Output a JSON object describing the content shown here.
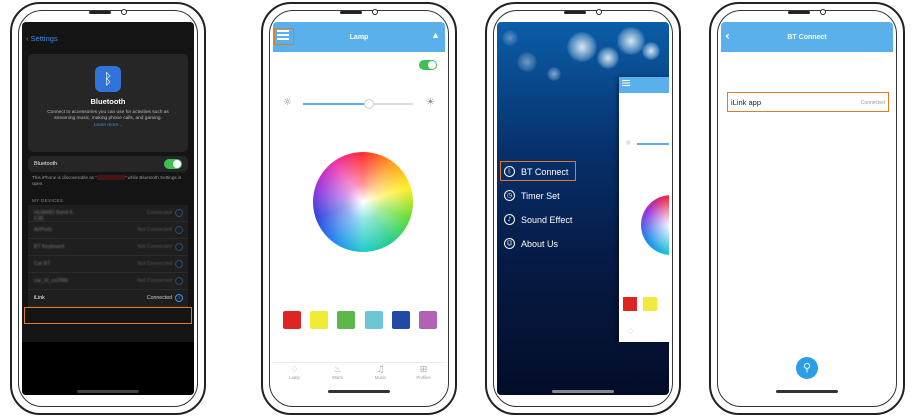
{
  "phone1": {
    "back_label": "Settings",
    "icon": "bluetooth-icon",
    "title": "Bluetooth",
    "description": "Connect to accessories you can use for activities such as streaming music, making phone calls, and gaming.",
    "learn_more": "Learn more...",
    "toggle_label": "Bluetooth",
    "toggle_on": true,
    "discoverable_prefix": "This iPhone is discoverable as “",
    "discoverable_suffix": "” while Bluetooth Settings is open.",
    "section_header": "MY DEVICES",
    "devices": [
      {
        "name": "HUAWEI Band 6-C9E",
        "status": "Connected"
      },
      {
        "name": "AirPods",
        "status": "Not Connected"
      },
      {
        "name": "BT Keyboard",
        "status": "Not Connected"
      },
      {
        "name": "Car BT",
        "status": "Not Connected"
      },
      {
        "name": "car_bt_ce298b",
        "status": "Not Connected"
      },
      {
        "name": "iLink",
        "status": "Connected"
      }
    ]
  },
  "phone2": {
    "title": "Lamp",
    "icons": {
      "menu": "menu-icon",
      "lamp": "lamp-icon",
      "sun_low": "brightness-low-icon",
      "sun_high": "brightness-high-icon"
    },
    "power_on": true,
    "brightness": 0.6,
    "swatches": [
      "#e02424",
      "#eeea3a",
      "#5cb84a",
      "#6cc6d4",
      "#1f4aa6",
      "#b262b4"
    ],
    "tabs": [
      {
        "label": "Lamp",
        "icon": "bulb-icon",
        "glyph": "♢"
      },
      {
        "label": "Warm",
        "icon": "flame-icon",
        "glyph": "♨"
      },
      {
        "label": "Music",
        "icon": "music-icon",
        "glyph": "♫"
      },
      {
        "label": "Profiles",
        "icon": "grid-icon",
        "glyph": "⊞"
      }
    ]
  },
  "phone3": {
    "menu": [
      {
        "label": "BT Connect",
        "icon": "bluetooth-icon",
        "glyph": "ᛒ"
      },
      {
        "label": "Timer Set",
        "icon": "clock-icon",
        "glyph": "◷"
      },
      {
        "label": "Sound Effect",
        "icon": "sound-icon",
        "glyph": "♪"
      },
      {
        "label": "About Us",
        "icon": "person-icon",
        "glyph": "☺"
      }
    ],
    "swatches": [
      "#e02424",
      "#eeea3a"
    ]
  },
  "phone4": {
    "title": "BT Connect",
    "back": "‹",
    "device": {
      "name": "iLink app",
      "status": "Connected"
    },
    "scan_icon": "search-icon",
    "scan_glyph": "⚲"
  },
  "colors": {
    "accent_blue": "#5ab0ea",
    "highlight_orange": "#e27a24",
    "ios_green": "#3fbf54"
  }
}
